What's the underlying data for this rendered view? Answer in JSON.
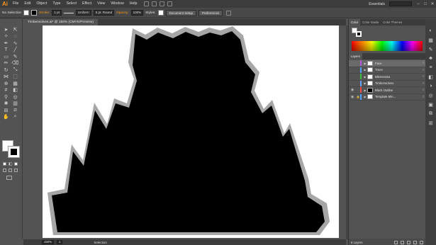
{
  "menubar": {
    "logo": "Ai",
    "items": [
      "File",
      "Edit",
      "Object",
      "Type",
      "Select",
      "Effect",
      "View",
      "Window",
      "Help"
    ],
    "workspace": "Essentials",
    "window_buttons": [
      "–",
      "□",
      "✕"
    ]
  },
  "control": {
    "selection": "No Selection",
    "stroke_label": "Stroke:",
    "stroke_weight": "1 pt",
    "profile": "Uniform",
    "brush": "5 pt. Round",
    "opacity_label": "Opacity:",
    "opacity_value": "100%",
    "styles_label": "Styles:",
    "document_setup": "Document Setup",
    "preferences": "Preferences"
  },
  "document": {
    "tab_title": "Timberwolves.ai* @ 150% (CMYK/Preview)"
  },
  "panels": {
    "color_tabs": [
      "Color",
      "Color Guide",
      "Color Themes"
    ],
    "layers_title": "Layers",
    "layers": [
      {
        "name": "Face",
        "color": "#b35ad9",
        "selected": true,
        "visible": false,
        "thumb": "white"
      },
      {
        "name": "Trees",
        "color": "#4fa3ff",
        "selected": false,
        "visible": false,
        "thumb": "white"
      },
      {
        "name": "Mlemesota",
        "color": "#3cc03c",
        "selected": false,
        "visible": false,
        "thumb": "white"
      },
      {
        "name": "Timberwolves",
        "color": "#6aa0ff",
        "selected": false,
        "visible": false,
        "thumb": "white"
      },
      {
        "name": "Black Outline",
        "color": "#ff4a4a",
        "selected": false,
        "visible": true,
        "thumb": "black"
      },
      {
        "name": "Template Min...",
        "color": "#4fa3ff",
        "selected": false,
        "visible": true,
        "thumb": "white"
      }
    ],
    "layers_count": "6 Layers"
  },
  "status": {
    "zoom": "150%",
    "artboard": "1",
    "tool": "Selection"
  },
  "colors": {
    "accent": "#f7941d",
    "canvas_bg": "#535353",
    "artboard": "#ffffff",
    "silhouette": "#000000",
    "outline": "#a6a6a6"
  }
}
